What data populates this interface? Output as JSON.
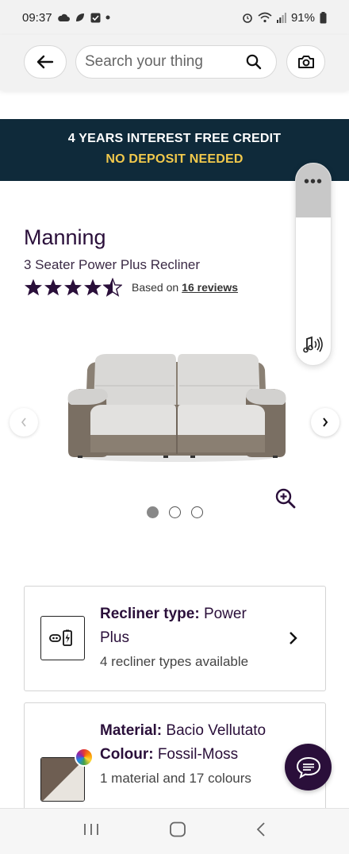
{
  "status_bar": {
    "time": "09:37",
    "battery": "91%",
    "left_icons": [
      "cloud-icon",
      "leaf-icon",
      "checkbox-icon",
      "dot-icon"
    ],
    "right_icons": [
      "alarm-icon",
      "wifi-icon",
      "signal-icon",
      "battery-icon"
    ]
  },
  "header": {
    "search_placeholder": "Search your thing",
    "back_icon": "back-arrow-icon",
    "search_icon": "search-icon",
    "camera_icon": "camera-icon"
  },
  "promo": {
    "line1": "4 YEARS INTEREST FREE CREDIT",
    "line2": "NO DEPOSIT NEEDED",
    "background_color": "#0f2a3a",
    "highlight_color": "#f2c94c"
  },
  "product": {
    "name": "Manning",
    "subtitle": "3 Seater Power Plus Recliner",
    "rating": 4.5,
    "rating_max": 5,
    "based_on_label": "Based on",
    "reviews_link": "16 reviews",
    "image_count": 3,
    "active_image": 0
  },
  "options": {
    "recliner": {
      "label": "Recliner type:",
      "value": "Power Plus",
      "sub": "4 recliner types available",
      "icon": "power-recliner-icon"
    },
    "material": {
      "material_label": "Material:",
      "material_value": "Bacio Vellutato",
      "colour_label": "Colour:",
      "colour_value": "Fossil-Moss",
      "sub": "1 material and 17 colours"
    }
  },
  "colors": {
    "brand": "#2a0f3a",
    "accent": "#f2c94c"
  },
  "nav": {
    "items": [
      "recent-apps-icon",
      "home-icon",
      "back-icon"
    ]
  }
}
